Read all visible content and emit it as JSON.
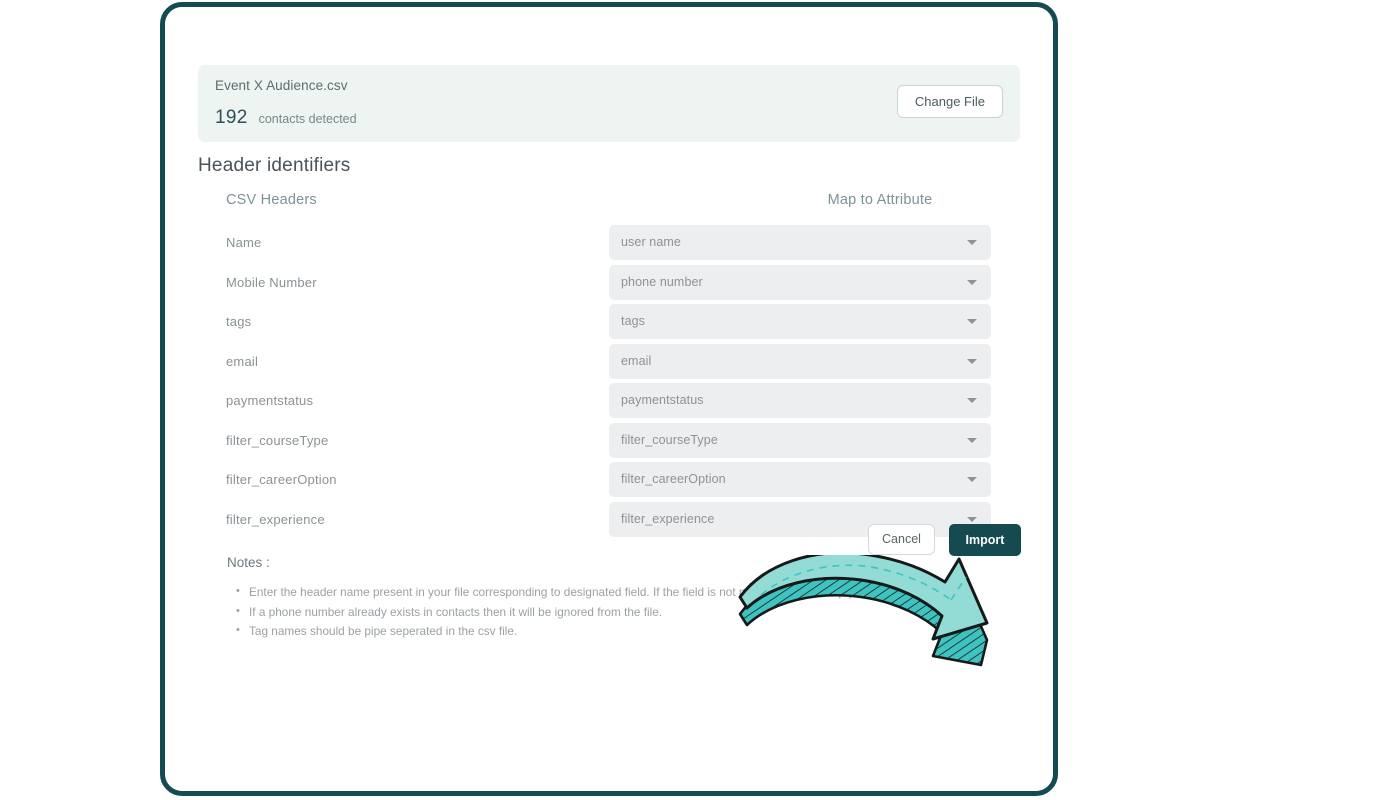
{
  "file_panel": {
    "file_name": "Event X Audience.csv",
    "contacts_count": "192",
    "contacts_label": "contacts detected",
    "change_file_label": "Change File"
  },
  "section": {
    "title": "Header identifiers",
    "column_headers": {
      "left": "CSV Headers",
      "right": "Map to Attribute"
    }
  },
  "mappings": [
    {
      "csv_header": "Name",
      "attribute": "user name"
    },
    {
      "csv_header": "Mobile Number",
      "attribute": "phone number"
    },
    {
      "csv_header": "tags",
      "attribute": "tags"
    },
    {
      "csv_header": "email",
      "attribute": "email"
    },
    {
      "csv_header": "paymentstatus",
      "attribute": "paymentstatus"
    },
    {
      "csv_header": "filter_courseType",
      "attribute": "filter_courseType"
    },
    {
      "csv_header": "filter_careerOption",
      "attribute": "filter_careerOption"
    },
    {
      "csv_header": "filter_experience",
      "attribute": "filter_experience"
    }
  ],
  "notes": {
    "title": "Notes :",
    "items": [
      "Enter the header name present in your file corresponding to designated field. If the field is not present leave it empty.",
      "If a phone number already exists in contacts then it will be ignored from the file.",
      "Tag names should be pipe seperated in the csv file."
    ]
  },
  "footer": {
    "cancel_label": "Cancel",
    "import_label": "Import"
  },
  "annotation": {
    "arrow": "curved-arrow-pointing-to-import"
  },
  "colors": {
    "frame_border": "#134b52",
    "panel_bg": "#edf4f1",
    "select_bg": "#eceef0",
    "import_bg": "#154a50",
    "arrow_fill": "#8fd9d4",
    "arrow_hatch": "#2bb5b5",
    "header_text": "#7d9296"
  }
}
